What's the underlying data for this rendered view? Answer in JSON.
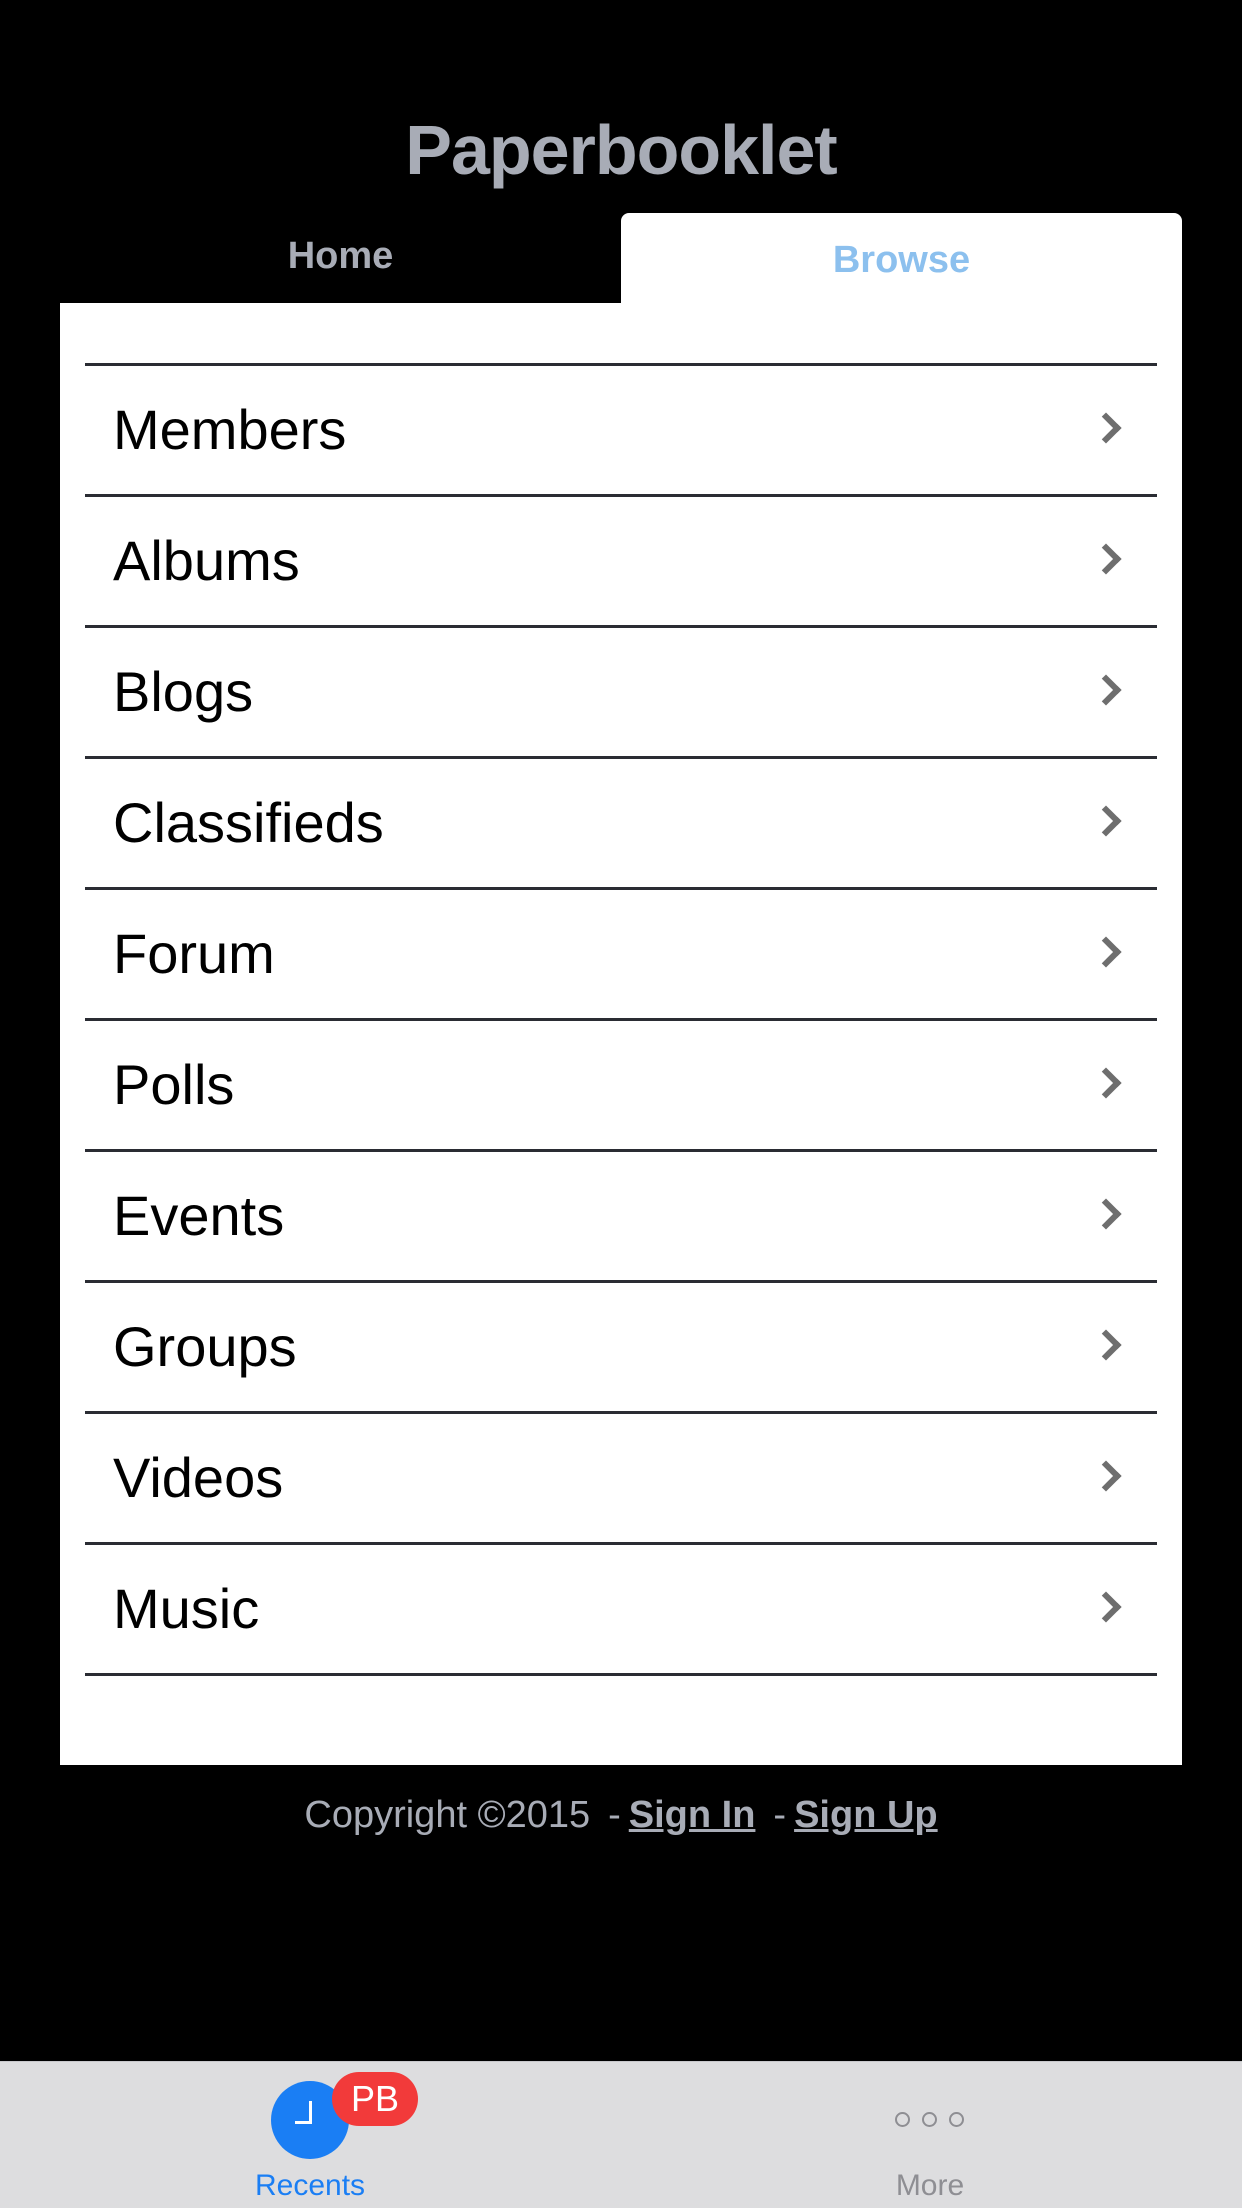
{
  "header": {
    "title": "Paperbooklet"
  },
  "tabs": [
    {
      "label": "Home"
    },
    {
      "label": "Browse"
    }
  ],
  "menu": {
    "items": [
      {
        "label": "Members"
      },
      {
        "label": "Albums"
      },
      {
        "label": "Blogs"
      },
      {
        "label": "Classifieds"
      },
      {
        "label": "Forum"
      },
      {
        "label": "Polls"
      },
      {
        "label": "Events"
      },
      {
        "label": "Groups"
      },
      {
        "label": "Videos"
      },
      {
        "label": "Music"
      }
    ],
    "chevron_icon": "chevron-right-icon"
  },
  "footer": {
    "copyright": "Copyright ©2015",
    "separator": "-",
    "sign_in": "Sign In",
    "sign_up": "Sign Up"
  },
  "tabbar": {
    "recents": {
      "label": "Recents",
      "badge": "PB",
      "icon": "clock-icon"
    },
    "more": {
      "label": "More",
      "icon": "more-dots-icon"
    }
  },
  "colors": {
    "background": "#000000",
    "title": "#a8acb6",
    "active_tab": "#8cc0ee",
    "accent": "#1a7ef4",
    "badge": "#f23a3a",
    "tabbar_bg": "#dddddf"
  }
}
